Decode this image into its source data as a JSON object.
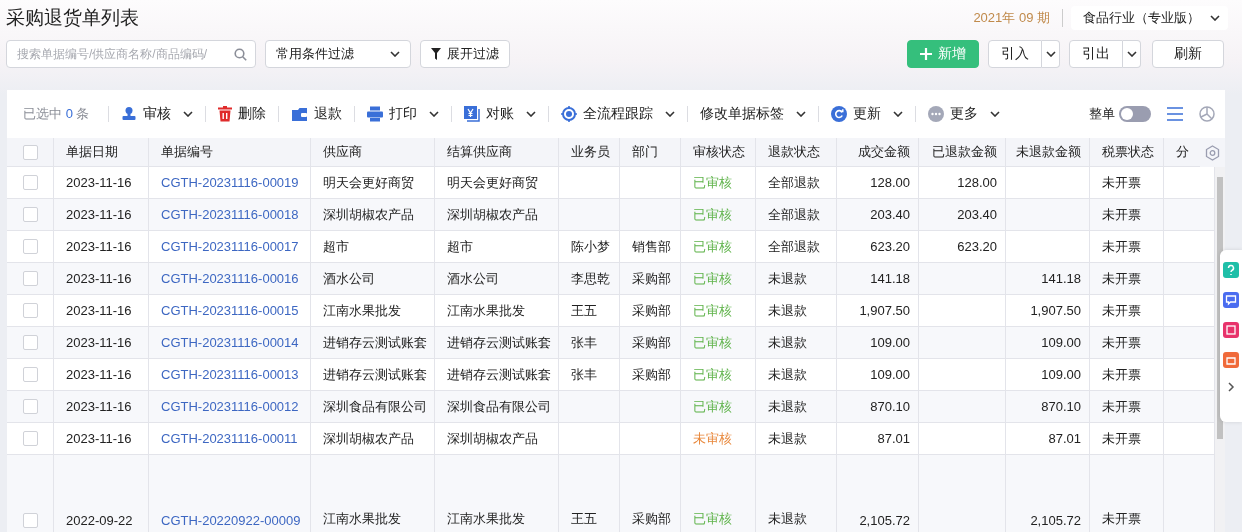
{
  "page_title": "采购退货单列表",
  "period": "2021年 09 期",
  "org_select": {
    "value": "食品行业（专业版）"
  },
  "search": {
    "placeholder": "搜索单据编号/供应商名称/商品编码/"
  },
  "filter_select": {
    "value": "常用条件过滤"
  },
  "expand_filter_button": "展开过滤",
  "actions": [
    {
      "label": "新增",
      "kind": "primary"
    },
    {
      "label": "引入",
      "kind": "split"
    },
    {
      "label": "引出",
      "kind": "split"
    },
    {
      "label": "刷新",
      "kind": "plain"
    }
  ],
  "selection": {
    "prefix": "已选中",
    "count": "0",
    "suffix": "条"
  },
  "toolbar": [
    {
      "label": "审核",
      "kind": "stamp",
      "dropdown": true
    },
    {
      "label": "删除",
      "kind": "trash",
      "dropdown": false
    },
    {
      "label": "退款",
      "kind": "wallet",
      "dropdown": false
    },
    {
      "label": "打印",
      "kind": "printer",
      "dropdown": true
    },
    {
      "label": "对账",
      "kind": "yen",
      "dropdown": true
    },
    {
      "label": "全流程跟踪",
      "kind": "target",
      "dropdown": true
    },
    {
      "label": "修改单据标签",
      "kind": "text",
      "dropdown": true
    },
    {
      "label": "更新",
      "kind": "refresh",
      "dropdown": true
    },
    {
      "label": "更多",
      "kind": "more",
      "dropdown": true
    }
  ],
  "whole_order": {
    "label": "整单",
    "on": false
  },
  "view_modes": [
    {
      "kind": "list",
      "selected": true
    },
    {
      "kind": "chart",
      "selected": false
    }
  ],
  "table": {
    "header_checked": false,
    "columns": [
      "单据日期",
      "单据编号",
      "供应商",
      "结算供应商",
      "业务员",
      "部门",
      "审核状态",
      "退款状态",
      "成交金额",
      "已退款金额",
      "未退款金额",
      "税票状态",
      "分"
    ],
    "rows": [
      {
        "checked": false,
        "date": "2023-11-16",
        "number": "CGTH-20231116-00019",
        "supplier": "明天会更好商贸",
        "settlement_supplier": "明天会更好商贸",
        "salesperson": "",
        "department": "",
        "audit_status": "已审核",
        "approved": true,
        "refund_status": "全部退款",
        "amount": "128.00",
        "refunded": "128.00",
        "unrefunded": "",
        "tax_status": "未开票"
      },
      {
        "checked": false,
        "date": "2023-11-16",
        "number": "CGTH-20231116-00018",
        "supplier": "深圳胡椒农产品",
        "settlement_supplier": "深圳胡椒农产品",
        "salesperson": "",
        "department": "",
        "audit_status": "已审核",
        "approved": true,
        "refund_status": "全部退款",
        "amount": "203.40",
        "refunded": "203.40",
        "unrefunded": "",
        "tax_status": "未开票"
      },
      {
        "checked": false,
        "date": "2023-11-16",
        "number": "CGTH-20231116-00017",
        "supplier": "超市",
        "settlement_supplier": "超市",
        "salesperson": "陈小梦",
        "department": "销售部",
        "audit_status": "已审核",
        "approved": true,
        "refund_status": "全部退款",
        "amount": "623.20",
        "refunded": "623.20",
        "unrefunded": "",
        "tax_status": "未开票"
      },
      {
        "checked": false,
        "date": "2023-11-16",
        "number": "CGTH-20231116-00016",
        "supplier": "酒水公司",
        "settlement_supplier": "酒水公司",
        "salesperson": "李思乾",
        "department": "采购部",
        "audit_status": "已审核",
        "approved": true,
        "refund_status": "未退款",
        "amount": "141.18",
        "refunded": "",
        "unrefunded": "141.18",
        "tax_status": "未开票"
      },
      {
        "checked": false,
        "date": "2023-11-16",
        "number": "CGTH-20231116-00015",
        "supplier": "江南水果批发",
        "settlement_supplier": "江南水果批发",
        "salesperson": "王五",
        "department": "采购部",
        "audit_status": "已审核",
        "approved": true,
        "refund_status": "未退款",
        "amount": "1,907.50",
        "refunded": "",
        "unrefunded": "1,907.50",
        "tax_status": "未开票"
      },
      {
        "checked": false,
        "date": "2023-11-16",
        "number": "CGTH-20231116-00014",
        "supplier": "进销存云测试账套",
        "settlement_supplier": "进销存云测试账套",
        "salesperson": "张丰",
        "department": "采购部",
        "audit_status": "已审核",
        "approved": true,
        "refund_status": "未退款",
        "amount": "109.00",
        "refunded": "",
        "unrefunded": "109.00",
        "tax_status": "未开票"
      },
      {
        "checked": false,
        "date": "2023-11-16",
        "number": "CGTH-20231116-00013",
        "supplier": "进销存云测试账套",
        "settlement_supplier": "进销存云测试账套",
        "salesperson": "张丰",
        "department": "采购部",
        "audit_status": "已审核",
        "approved": true,
        "refund_status": "未退款",
        "amount": "109.00",
        "refunded": "",
        "unrefunded": "109.00",
        "tax_status": "未开票"
      },
      {
        "checked": false,
        "date": "2023-11-16",
        "number": "CGTH-20231116-00012",
        "supplier": "深圳食品有限公司",
        "settlement_supplier": "深圳食品有限公司",
        "salesperson": "",
        "department": "",
        "audit_status": "已审核",
        "approved": true,
        "refund_status": "未退款",
        "amount": "870.10",
        "refunded": "",
        "unrefunded": "870.10",
        "tax_status": "未开票"
      },
      {
        "checked": false,
        "date": "2023-11-16",
        "number": "CGTH-20231116-00011",
        "supplier": "深圳胡椒农产品",
        "settlement_supplier": "深圳胡椒农产品",
        "salesperson": "",
        "department": "",
        "audit_status": "未审核",
        "approved": false,
        "refund_status": "未退款",
        "amount": "87.01",
        "refunded": "",
        "unrefunded": "87.01",
        "tax_status": "未开票"
      },
      {
        "checked": false,
        "date": "2022-09-22",
        "number": "CGTH-20220922-00009",
        "supplier": "江南水果批发",
        "settlement_supplier": "江南水果批发",
        "salesperson": "王五",
        "department": "采购部",
        "audit_status": "已审核",
        "approved": true,
        "refund_status": "未退款",
        "amount": "2,105.72",
        "refunded": "",
        "unrefunded": "2,105.72",
        "tax_status": "未开票"
      }
    ]
  }
}
